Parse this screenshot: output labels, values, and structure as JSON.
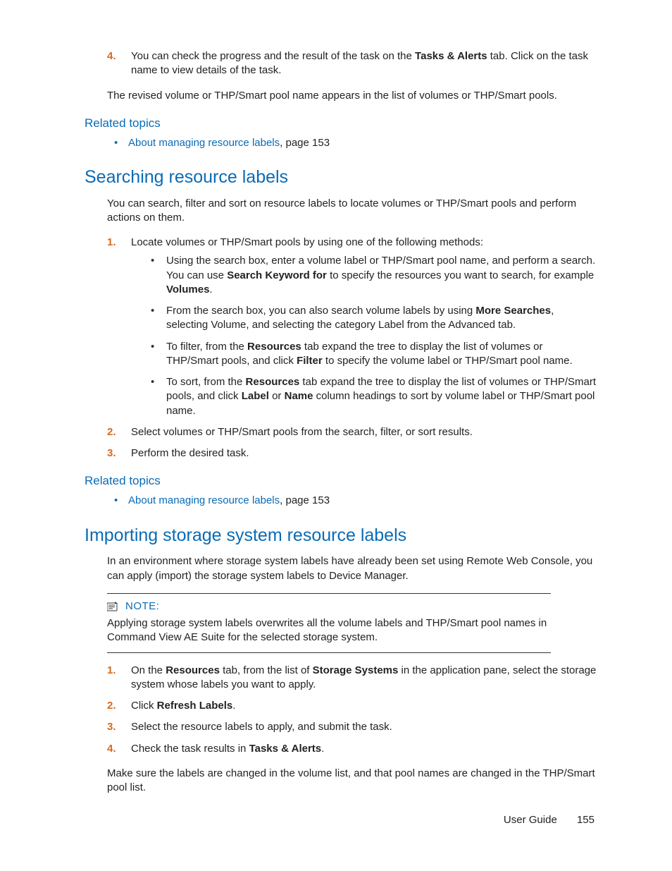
{
  "top_step": {
    "num": "4.",
    "text_a": "You can check the progress and the result of the task on the ",
    "bold_a": "Tasks & Alerts",
    "text_b": " tab. Click on the task name to view details of the task."
  },
  "top_para": "The revised volume or THP/Smart pool name appears in the list of volumes or THP/Smart pools.",
  "related1": {
    "heading": "Related topics",
    "link": "About managing resource labels",
    "suffix": ", page 153"
  },
  "section1": {
    "heading": "Searching resource labels",
    "intro": "You can search, filter and sort on resource labels to locate volumes or THP/Smart pools and perform actions on them.",
    "step1": {
      "num": "1.",
      "text": "Locate volumes or THP/Smart pools by using one of the following methods:",
      "b1": {
        "a": "Using the search box, enter a volume label or THP/Smart pool name, and perform a search. You can use ",
        "bold1": "Search Keyword for",
        "b": " to specify the resources you want to search, for example ",
        "bold2": "Volumes",
        "c": "."
      },
      "b2": {
        "a": "From the search box, you can also search volume labels by using ",
        "bold1": "More Searches",
        "b": ", selecting Volume, and selecting the category Label from the Advanced tab."
      },
      "b3": {
        "a": "To filter, from the ",
        "bold1": "Resources",
        "b": " tab expand the tree to display the list of volumes or THP/Smart pools, and click ",
        "bold2": "Filter",
        "c": " to specify the volume label or THP/Smart pool name."
      },
      "b4": {
        "a": "To sort, from the ",
        "bold1": "Resources",
        "b": " tab expand the tree to display the list of volumes or THP/Smart pools, and click ",
        "bold2": "Label",
        "c": " or ",
        "bold3": "Name",
        "d": " column headings to sort by volume label or THP/Smart pool name."
      }
    },
    "step2": {
      "num": "2.",
      "text": "Select volumes or THP/Smart pools from the search, filter, or sort results."
    },
    "step3": {
      "num": "3.",
      "text": "Perform the desired task."
    }
  },
  "related2": {
    "heading": "Related topics",
    "link": "About managing resource labels",
    "suffix": ", page 153"
  },
  "section2": {
    "heading": "Importing storage system resource labels",
    "intro": "In an environment where storage system labels have already been set using Remote Web Console, you can apply (import) the storage system labels to Device Manager.",
    "note_label": "NOTE:",
    "note_body": "Applying storage system labels overwrites all the volume labels and THP/Smart pool names in Command View AE Suite for the selected storage system.",
    "step1": {
      "num": "1.",
      "a": "On the ",
      "bold1": "Resources",
      "b": " tab, from the list of ",
      "bold2": "Storage Systems",
      "c": " in the application pane, select the storage system whose labels you want to apply."
    },
    "step2": {
      "num": "2.",
      "a": "Click ",
      "bold1": "Refresh Labels",
      "b": "."
    },
    "step3": {
      "num": "3.",
      "text": "Select the resource labels to apply, and submit the task."
    },
    "step4": {
      "num": "4.",
      "a": "Check the task results in ",
      "bold1": "Tasks & Alerts",
      "b": "."
    },
    "outro": "Make sure the labels are changed in the volume list, and that pool names are changed in the THP/Smart pool list."
  },
  "footer": {
    "label": "User Guide",
    "page": "155"
  }
}
